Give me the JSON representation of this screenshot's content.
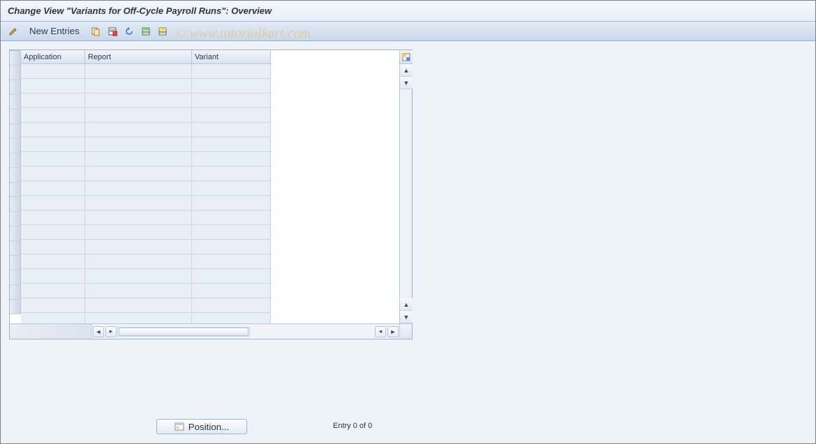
{
  "title": "Change View \"Variants for Off-Cycle Payroll Runs\": Overview",
  "watermark": "© www.tutorialkart.com",
  "toolbar": {
    "new_entries_label": "New Entries"
  },
  "table": {
    "headers": {
      "application": "Application",
      "report": "Report",
      "variant": "Variant"
    },
    "row_count": 18,
    "rows": []
  },
  "footer": {
    "position_label": "Position...",
    "entry_text": "Entry 0 of 0"
  }
}
